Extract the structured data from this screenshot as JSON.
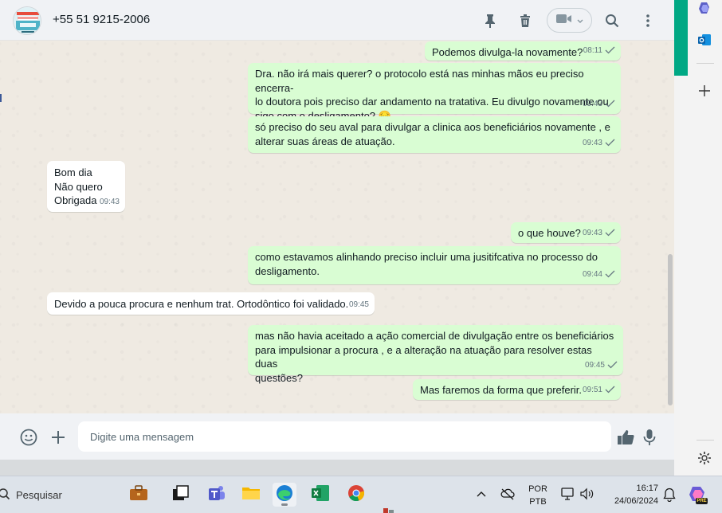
{
  "header": {
    "contact_name": "+55 51 9215-2006",
    "icons": [
      "pin-icon",
      "trash-icon",
      "video-call-icon",
      "chevron-down-icon",
      "search-icon",
      "menu-icon"
    ]
  },
  "messages": [
    {
      "direction": "outgoing",
      "text": "Podemos divulga-la novamente?",
      "time": "08:11"
    },
    {
      "direction": "outgoing",
      "text": "Dra. não irá mais querer? o protocolo está nas minhas mãos eu preciso encerra-\nlo doutora pois preciso dar andamento na tratativa. Eu divulgo novamente ou\nsigo com o desligamento? 😔",
      "time": "09:43"
    },
    {
      "direction": "outgoing",
      "text": "só preciso do seu aval para divulgar a clinica aos beneficiários novamente , e\nalterar suas áreas de atuação.",
      "time": "09:43"
    },
    {
      "direction": "incoming",
      "text": "Bom dia\nNão quero\nObrigada",
      "time": "09:43"
    },
    {
      "direction": "outgoing",
      "text": "o que houve?",
      "time": "09:43"
    },
    {
      "direction": "outgoing",
      "text": "como estavamos alinhando preciso incluir uma jusitifcativa no processo do\ndesligamento.",
      "time": "09:44"
    },
    {
      "direction": "incoming",
      "text": "Devido a pouca procura e nenhum trat. Ortodôntico foi validado.",
      "time": "09:45"
    },
    {
      "direction": "outgoing",
      "text": "mas não havia aceitado a ação comercial de divulgação entre os beneficiários\npara impulsionar a procura , e a alteração na atuação para resolver estas duas\nquestões?",
      "time": "09:45"
    },
    {
      "direction": "outgoing",
      "text": "Mas faremos da forma que preferir.",
      "time": "09:51"
    }
  ],
  "composer": {
    "placeholder": "Digite uma mensagem"
  },
  "taskbar": {
    "search_label": "Pesquisar",
    "language_top": "POR",
    "language_bottom": "PTB",
    "time": "16:17",
    "date": "24/06/2024",
    "copilot_badge": "PRE"
  },
  "colors": {
    "outgoing_bubble": "#d9fdd3",
    "incoming_bubble": "#ffffff",
    "chat_background": "#efeae2",
    "accent_green": "#00a884"
  }
}
